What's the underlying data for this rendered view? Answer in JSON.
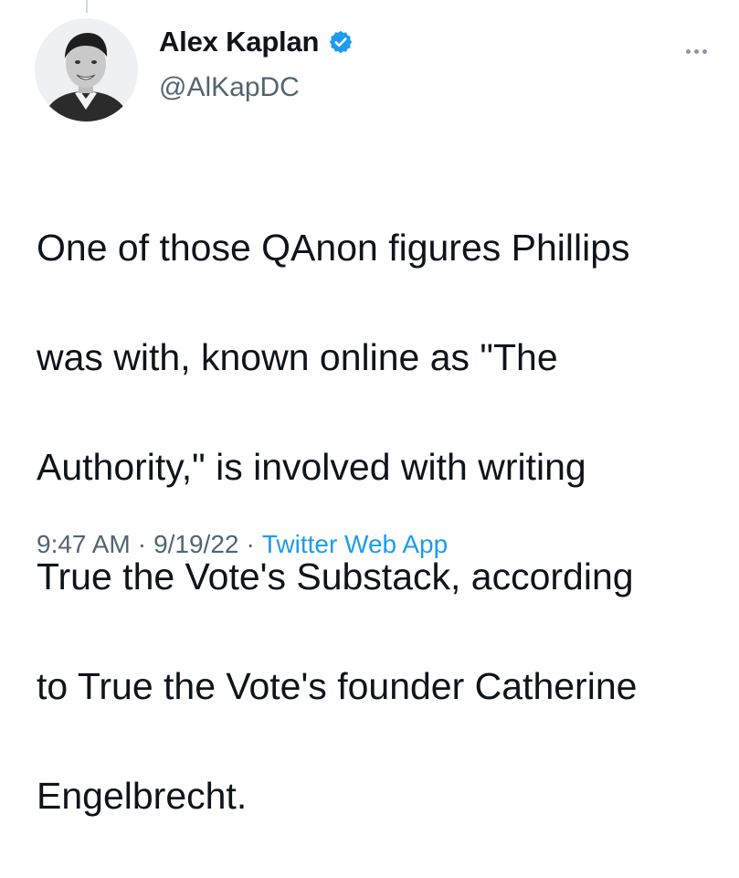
{
  "author": {
    "display_name": "Alex Kaplan",
    "handle": "@AlKapDC",
    "verified": true
  },
  "icons": {
    "verified": "verified-badge-icon",
    "more": "more-options-icon"
  },
  "colors": {
    "text": "#0f1419",
    "secondary": "#536471",
    "accent": "#1d9bf0"
  },
  "tweet": {
    "lines": [
      "One of those QAnon figures Phillips",
      "was with, known online as \"The",
      "Authority,\" is involved with writing",
      "True the Vote's Substack, according",
      "to True the Vote's founder Catherine",
      "Engelbrecht."
    ]
  },
  "meta": {
    "time": "9:47 AM",
    "separator": "·",
    "date": "9/19/22",
    "source": "Twitter Web App"
  }
}
